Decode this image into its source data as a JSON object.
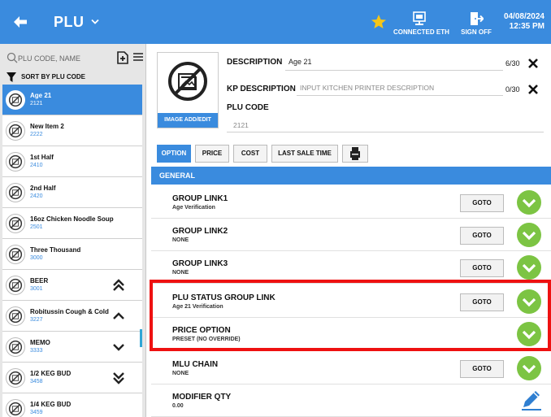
{
  "header": {
    "title": "PLU",
    "connection_label": "CONNECTED ETH",
    "signoff_label": "SIGN OFF",
    "date": "04/08/2024",
    "time": "12:35 PM",
    "bar_color": "#3a8bde"
  },
  "sidebar": {
    "search_placeholder": "PLU CODE, NAME",
    "sort_label": "SORT BY PLU CODE",
    "items": [
      {
        "name": "Age 21",
        "code": "2121",
        "selected": true
      },
      {
        "name": "New Item 2",
        "code": "2222"
      },
      {
        "name": "1st Half",
        "code": "2410"
      },
      {
        "name": "2nd Half",
        "code": "2420"
      },
      {
        "name": "16oz Chicken Noodle Soup",
        "code": "2501"
      },
      {
        "name": "Three Thousand",
        "code": "3000"
      },
      {
        "name": "BEER",
        "code": "3001",
        "scroll_icon": "double-chevron-up-icon"
      },
      {
        "name": "Robitussin Cough & Cold",
        "code": "3227",
        "scroll_icon": "chevron-up-icon"
      },
      {
        "name": "MEMO",
        "code": "3333",
        "scroll_icon": "chevron-down-icon"
      },
      {
        "name": "1/2 KEG BUD",
        "code": "3458",
        "scroll_icon": "double-chevron-down-icon"
      },
      {
        "name": "1/4 KEG BUD",
        "code": "3459"
      }
    ]
  },
  "detail": {
    "image_button": "IMAGE ADD/EDIT",
    "description_label": "DESCRIPTION",
    "description_value": "Age 21",
    "description_count": "6/30",
    "kp_label": "KP DESCRIPTION",
    "kp_placeholder": "INPUT KITCHEN PRINTER DESCRIPTION",
    "kp_count": "0/30",
    "plu_code_label": "PLU CODE",
    "plu_code_value": "2121"
  },
  "tabs": {
    "option": "OPTION",
    "price": "PRICE",
    "cost": "COST",
    "last_sale_time": "LAST SALE TIME"
  },
  "section": {
    "title": "GENERAL"
  },
  "goto_label": "GOTO",
  "options": [
    {
      "label": "GROUP LINK1",
      "sub": "Age Verification",
      "goto": true,
      "action_icon": "check-circle-icon"
    },
    {
      "label": "GROUP LINK2",
      "sub": "NONE",
      "goto": true,
      "action_icon": "check-circle-icon"
    },
    {
      "label": "GROUP LINK3",
      "sub": "NONE",
      "goto": true,
      "action_icon": "check-circle-icon"
    },
    {
      "label": "PLU STATUS GROUP LINK",
      "sub": "Age 21 Verification",
      "goto": true,
      "action_icon": "check-circle-icon"
    },
    {
      "label": "PRICE OPTION",
      "sub": "PRESET (NO OVERRIDE)",
      "goto": false,
      "action_icon": "check-circle-icon"
    },
    {
      "label": "MLU CHAIN",
      "sub": "NONE",
      "goto": true,
      "action_icon": "check-circle-icon"
    },
    {
      "label": "MODIFIER QTY",
      "sub": "0.00",
      "goto": false,
      "action_icon": "pencil-icon"
    }
  ],
  "colors": {
    "accent": "#3a8bde",
    "check_green": "#7cc443",
    "highlight_red": "#ee1111"
  }
}
